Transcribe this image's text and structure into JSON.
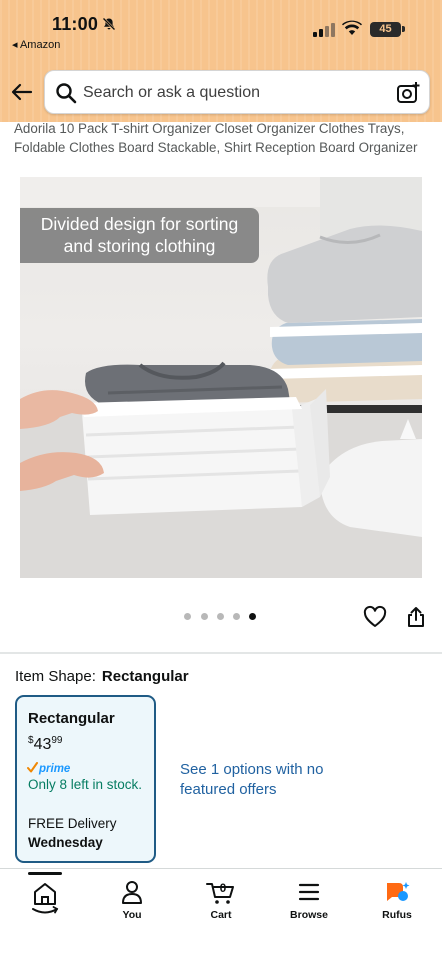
{
  "status_bar": {
    "time": "11:00",
    "back_app": "◂ Amazon",
    "battery": "45"
  },
  "search": {
    "placeholder": "Search or ask a question"
  },
  "product": {
    "title": "Adorila 10 Pack T-shirt Organizer Closet Organizer Clothes Trays, Foldable Clothes Board Stackable, Shirt Reception Board Organizer",
    "image_caption_line1": "Divided design for sorting",
    "image_caption_line2": "and storing clothing",
    "image_count": 4,
    "active_image": 4
  },
  "item_shape": {
    "label": "Item Shape:",
    "value": "Rectangular"
  },
  "option": {
    "name": "Rectangular",
    "price_currency": "$",
    "price_whole": "43",
    "price_cents": "99",
    "prime_label": "prime",
    "stock": "Only 8 left in stock.",
    "delivery": "FREE Delivery",
    "delivery_day": "Wednesday"
  },
  "see_options": "See 1 options with no featured offers",
  "cart_count": "0",
  "nav": {
    "you": "You",
    "cart": "Cart",
    "browse": "Browse",
    "rufus": "Rufus"
  },
  "colors": {
    "header": "#f7c48d",
    "option_border": "#1f5b85",
    "option_bg": "#edf7fb",
    "stock_green": "#067d62",
    "link_blue": "#2162a1",
    "prime_blue": "#1a98ff",
    "rufus_orange": "#ff6a13"
  }
}
